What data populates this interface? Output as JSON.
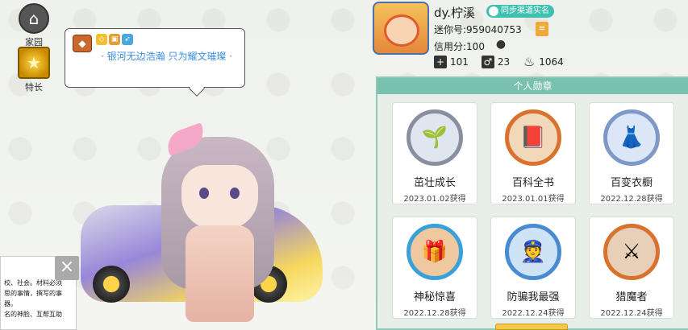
{
  "left_nav": {
    "home_label": "家园",
    "special_label": "特长"
  },
  "bubble": {
    "text": "· 银河无边浩瀚 只为耀文璀璨 ·"
  },
  "document": {
    "lines": [
      "校、社会。材料必须",
      "思的事情，撰写的事",
      "器。",
      "名的神脸、互帮互助"
    ]
  },
  "profile": {
    "username": "dy.柠溪",
    "sync_label": "同步渠道实名",
    "mini_id": "迷你号:959040753",
    "credit": "信用分:100",
    "stats": [
      {
        "icon": "plus-icon",
        "value": "101"
      },
      {
        "icon": "cheer-icon",
        "value": "23"
      },
      {
        "icon": "flame-icon",
        "value": "1064"
      }
    ]
  },
  "medals": {
    "title": "个人勋章",
    "items": [
      {
        "name": "茁壮成长",
        "date": "2023.01.02获得",
        "icon": "sprout-medal-icon",
        "color": "#8a8fa0"
      },
      {
        "name": "百科全书",
        "date": "2023.01.01获得",
        "icon": "book-medal-icon",
        "color": "#d9722e"
      },
      {
        "name": "百变衣橱",
        "date": "2022.12.28获得",
        "icon": "wardrobe-medal-icon",
        "color": "#7e98c8"
      },
      {
        "name": "神秘惊喜",
        "date": "2022.12.28获得",
        "icon": "giftbox-medal-icon",
        "color": "#3aa0d8"
      },
      {
        "name": "防骗我最强",
        "date": "2022.12.24获得",
        "icon": "police-medal-icon",
        "color": "#4a8ad0"
      },
      {
        "name": "猎魔者",
        "date": "2022.12.24获得",
        "icon": "sword-medal-icon",
        "color": "#d9722e"
      }
    ]
  }
}
